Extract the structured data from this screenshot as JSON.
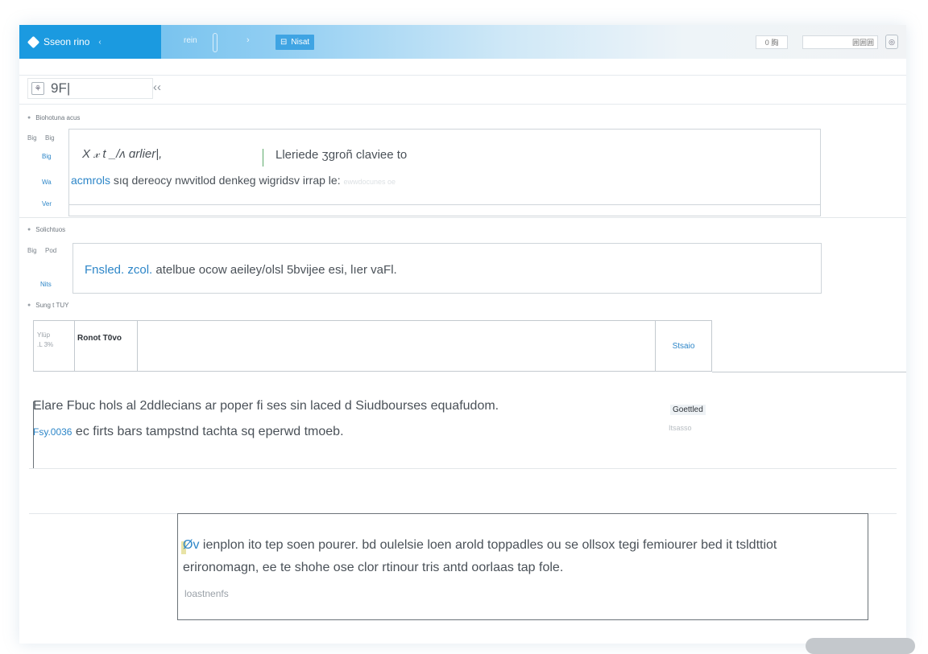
{
  "topbar": {
    "brand": "Sseon rino",
    "caret": "‹",
    "crumb": "rein",
    "arrow": "›",
    "next_label": "Nisat",
    "field_a": "0 胸",
    "field_b": "囲囲囲",
    "icon": "◎"
  },
  "search": {
    "value": "9F|",
    "collapse": "‹‹",
    "icon": "search-icon"
  },
  "section1": {
    "label": "Biohotuna acus",
    "side": [
      "Big",
      "Big",
      "Wa",
      "Ver"
    ],
    "line1_a": "X 𝓍 t _/ʌ ɑrlier|,",
    "line1_b": "Lleriede ʒgroñ claviee to",
    "line2_a": "acmrols",
    "line2_b": " sıq dereocy nwvitlod denkeg wigridsv irrap le:",
    "ghost": "ewwdocunes oe"
  },
  "section2": {
    "label": "Solichtuos",
    "side": [
      "Big",
      "Pod",
      "Nits"
    ],
    "text_hl": "Fnsled. zcol.",
    "text_rest": " atelbue ocow aeiley/olsl 5bvijee esi, lıer vaFl."
  },
  "section3": {
    "label": "Sung t TUY",
    "table": {
      "col0": [
        "Ylüp",
        ".L 3%"
      ],
      "col1": "Ronot T0vo",
      "col3": "Stsaio"
    }
  },
  "lead": {
    "line1": "Elare  Fbuc hols al 2ddlecians ar poper fi ses sin laced d Siudbourses equafudom.",
    "line2_hl": "Fsy.0036",
    "line2_rest": " ec firts bars tampstnd tachta sq eperwd tmoeb."
  },
  "status": {
    "a": "Goettled",
    "b": "Itsasso"
  },
  "card": {
    "line1_hl": "Øv",
    "line1_rest": " ienplon ito tep soen pourer. bd oulelsie loen arold toppadles ou se ollsox tegi femiourer bed it tsldttiot",
    "line2": "erironomagn, ee te shohe ose clor rtinour tris antd oorlaas tap fole.",
    "foot": "loastnenfs"
  }
}
